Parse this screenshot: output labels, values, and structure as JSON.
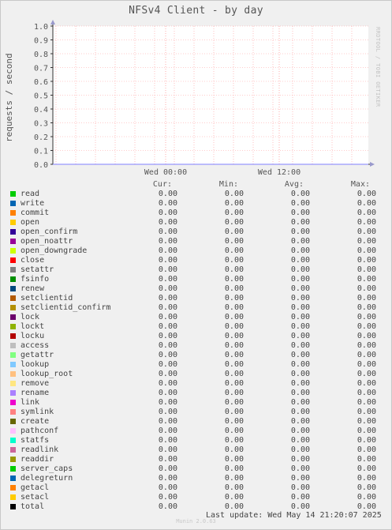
{
  "title": "NFSv4 Client - by day",
  "watermark": "RRDTOOL / TOBI OETIKER",
  "footer": {
    "last_update": "Last update: Wed May 14 21:20:07 2025",
    "version": "Munin 2.0.63"
  },
  "legend_headers": {
    "cur": "Cur:",
    "min": "Min:",
    "avg": "Avg:",
    "max": "Max:"
  },
  "colors": {
    "background": "#f0f0f0",
    "plot": "#ffffff",
    "grid": "#ff9999",
    "axis": "#333333",
    "zero_line": "#8080ff"
  },
  "chart_data": {
    "type": "line",
    "title": "NFSv4 Client - by day",
    "ylabel": "requests / second",
    "xlabel": "",
    "ylim": [
      0,
      1.0
    ],
    "y_ticks": [
      "0.0",
      "0.1",
      "0.2",
      "0.3",
      "0.4",
      "0.5",
      "0.6",
      "0.7",
      "0.8",
      "0.9",
      "1.0"
    ],
    "x_ticks": [
      "Wed 00:00",
      "Wed 12:00"
    ],
    "grid": true,
    "legend_placement": "bottom",
    "series": [
      {
        "name": "read",
        "color": "#00cc00",
        "cur": "0.00",
        "min": "0.00",
        "avg": "0.00",
        "max": "0.00"
      },
      {
        "name": "write",
        "color": "#0066b3",
        "cur": "0.00",
        "min": "0.00",
        "avg": "0.00",
        "max": "0.00"
      },
      {
        "name": "commit",
        "color": "#ff8000",
        "cur": "0.00",
        "min": "0.00",
        "avg": "0.00",
        "max": "0.00"
      },
      {
        "name": "open",
        "color": "#ffcc00",
        "cur": "0.00",
        "min": "0.00",
        "avg": "0.00",
        "max": "0.00"
      },
      {
        "name": "open_confirm",
        "color": "#330099",
        "cur": "0.00",
        "min": "0.00",
        "avg": "0.00",
        "max": "0.00"
      },
      {
        "name": "open_noattr",
        "color": "#990099",
        "cur": "0.00",
        "min": "0.00",
        "avg": "0.00",
        "max": "0.00"
      },
      {
        "name": "open_downgrade",
        "color": "#ccff00",
        "cur": "0.00",
        "min": "0.00",
        "avg": "0.00",
        "max": "0.00"
      },
      {
        "name": "close",
        "color": "#ff0000",
        "cur": "0.00",
        "min": "0.00",
        "avg": "0.00",
        "max": "0.00"
      },
      {
        "name": "setattr",
        "color": "#808080",
        "cur": "0.00",
        "min": "0.00",
        "avg": "0.00",
        "max": "0.00"
      },
      {
        "name": "fsinfo",
        "color": "#008f00",
        "cur": "0.00",
        "min": "0.00",
        "avg": "0.00",
        "max": "0.00"
      },
      {
        "name": "renew",
        "color": "#00487d",
        "cur": "0.00",
        "min": "0.00",
        "avg": "0.00",
        "max": "0.00"
      },
      {
        "name": "setclientid",
        "color": "#b35a00",
        "cur": "0.00",
        "min": "0.00",
        "avg": "0.00",
        "max": "0.00"
      },
      {
        "name": "setclientid_confirm",
        "color": "#b38f00",
        "cur": "0.00",
        "min": "0.00",
        "avg": "0.00",
        "max": "0.00"
      },
      {
        "name": "lock",
        "color": "#6b006b",
        "cur": "0.00",
        "min": "0.00",
        "avg": "0.00",
        "max": "0.00"
      },
      {
        "name": "lockt",
        "color": "#8fb300",
        "cur": "0.00",
        "min": "0.00",
        "avg": "0.00",
        "max": "0.00"
      },
      {
        "name": "locku",
        "color": "#b30000",
        "cur": "0.00",
        "min": "0.00",
        "avg": "0.00",
        "max": "0.00"
      },
      {
        "name": "access",
        "color": "#bebebe",
        "cur": "0.00",
        "min": "0.00",
        "avg": "0.00",
        "max": "0.00"
      },
      {
        "name": "getattr",
        "color": "#80ff80",
        "cur": "0.00",
        "min": "0.00",
        "avg": "0.00",
        "max": "0.00"
      },
      {
        "name": "lookup",
        "color": "#80c9ff",
        "cur": "0.00",
        "min": "0.00",
        "avg": "0.00",
        "max": "0.00"
      },
      {
        "name": "lookup_root",
        "color": "#ffc080",
        "cur": "0.00",
        "min": "0.00",
        "avg": "0.00",
        "max": "0.00"
      },
      {
        "name": "remove",
        "color": "#ffe680",
        "cur": "0.00",
        "min": "0.00",
        "avg": "0.00",
        "max": "0.00"
      },
      {
        "name": "rename",
        "color": "#aa80ff",
        "cur": "0.00",
        "min": "0.00",
        "avg": "0.00",
        "max": "0.00"
      },
      {
        "name": "link",
        "color": "#ee00cc",
        "cur": "0.00",
        "min": "0.00",
        "avg": "0.00",
        "max": "0.00"
      },
      {
        "name": "symlink",
        "color": "#ff8080",
        "cur": "0.00",
        "min": "0.00",
        "avg": "0.00",
        "max": "0.00"
      },
      {
        "name": "create",
        "color": "#666600",
        "cur": "0.00",
        "min": "0.00",
        "avg": "0.00",
        "max": "0.00"
      },
      {
        "name": "pathconf",
        "color": "#ffbfff",
        "cur": "0.00",
        "min": "0.00",
        "avg": "0.00",
        "max": "0.00"
      },
      {
        "name": "statfs",
        "color": "#00ffcc",
        "cur": "0.00",
        "min": "0.00",
        "avg": "0.00",
        "max": "0.00"
      },
      {
        "name": "readlink",
        "color": "#cc6699",
        "cur": "0.00",
        "min": "0.00",
        "avg": "0.00",
        "max": "0.00"
      },
      {
        "name": "readdir",
        "color": "#999900",
        "cur": "0.00",
        "min": "0.00",
        "avg": "0.00",
        "max": "0.00"
      },
      {
        "name": "server_caps",
        "color": "#00cc00",
        "cur": "0.00",
        "min": "0.00",
        "avg": "0.00",
        "max": "0.00"
      },
      {
        "name": "delegreturn",
        "color": "#0066b3",
        "cur": "0.00",
        "min": "0.00",
        "avg": "0.00",
        "max": "0.00"
      },
      {
        "name": "getacl",
        "color": "#ff8000",
        "cur": "0.00",
        "min": "0.00",
        "avg": "0.00",
        "max": "0.00"
      },
      {
        "name": "setacl",
        "color": "#ffcc00",
        "cur": "0.00",
        "min": "0.00",
        "avg": "0.00",
        "max": "0.00"
      },
      {
        "name": "total",
        "color": "#000000",
        "cur": "0.00",
        "min": "0.00",
        "avg": "0.00",
        "max": "0.00"
      }
    ]
  }
}
